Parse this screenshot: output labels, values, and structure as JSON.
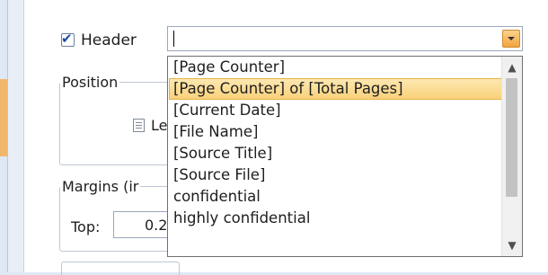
{
  "header": {
    "checked": true,
    "label": "Header",
    "value": ""
  },
  "position": {
    "legend": "Position",
    "left_option_label": "Le"
  },
  "margins": {
    "legend": "Margins (ir",
    "top_label": "Top:",
    "top_value": "0.2"
  },
  "dropdown": {
    "items": [
      "[Page Counter]",
      "[Page Counter] of [Total Pages]",
      "[Current Date]",
      "[File Name]",
      "[Source Title]",
      "[Source File]",
      "confidential",
      "highly confidential"
    ],
    "highlighted_index": 1
  },
  "icons": {
    "checkbox_tick": "✔",
    "scroll_up": "▲",
    "scroll_down": "▼",
    "combo_button": "chevron-down-icon",
    "left_align": "left-align-icon"
  },
  "colors": {
    "accent_orange": "#f3a440",
    "highlight": "#fde7b1",
    "background": "#dfe8f5"
  }
}
